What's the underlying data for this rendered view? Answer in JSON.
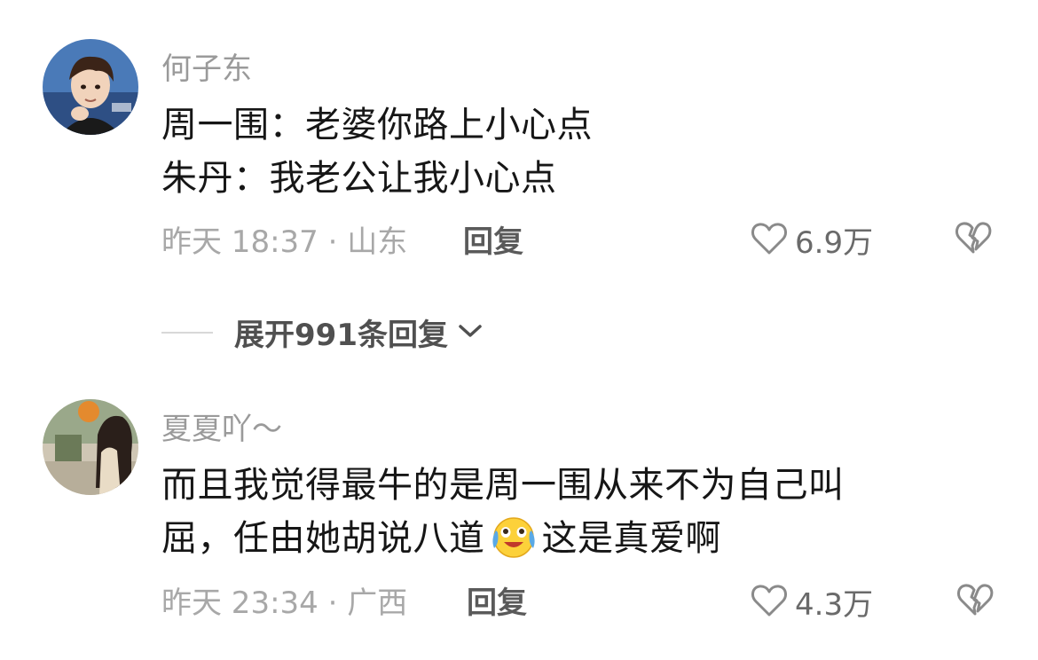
{
  "comments": [
    {
      "username": "何子东",
      "lines": [
        "周一围：老婆你路上小心点",
        "朱丹：我老公让我小心点"
      ],
      "time": "昨天 18:37 · 山东",
      "reply_label": "回复",
      "likes": "6.9万"
    },
    {
      "username": "夏夏吖～",
      "lines": [
        "而且我觉得最牛的是周一围从来不为自己叫",
        "屈，任由她胡说八道",
        "这是真爱啊"
      ],
      "emoji": "crying-laughing-emoji",
      "time": "昨天 23:34 · 广西",
      "reply_label": "回复",
      "likes": "4.3万"
    }
  ],
  "expand_replies": {
    "label": "展开991条回复"
  }
}
